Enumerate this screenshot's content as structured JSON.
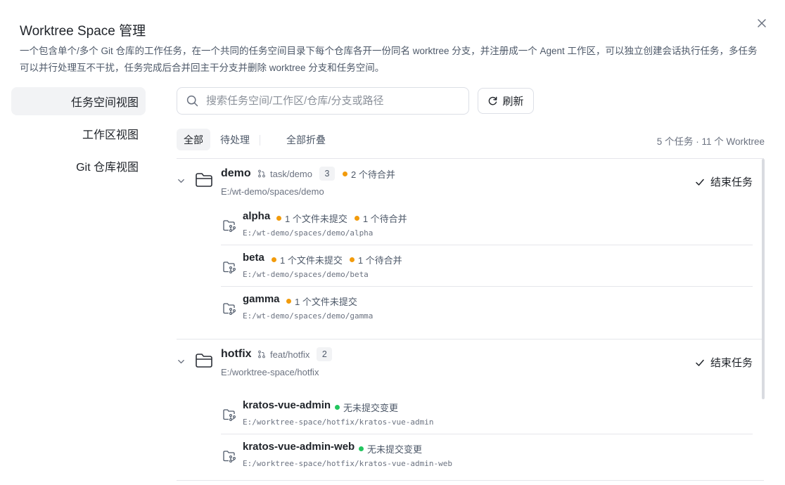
{
  "dialog": {
    "title": "Worktree Space 管理",
    "description": "一个包含单个/多个 Git 仓库的工作任务，在一个共同的任务空间目录下每个仓库各开一份同名 worktree 分支，并注册成一个 Agent 工作区，可以独立创建会话执行任务，多任务可以并行处理互不干扰，任务完成后合并回主干分支并删除 worktree 分支和任务空间。"
  },
  "sidebar": {
    "items": [
      {
        "label": "任务空间视图",
        "active": true
      },
      {
        "label": "工作区视图",
        "active": false
      },
      {
        "label": "Git 仓库视图",
        "active": false
      }
    ]
  },
  "search": {
    "placeholder": "搜索任务空间/工作区/仓库/分支或路径",
    "value": ""
  },
  "refresh_label": "刷新",
  "filters": {
    "all": "全部",
    "pending": "待处理",
    "collapse_all": "全部折叠",
    "summary": "5 个任务 · 11 个 Worktree"
  },
  "finish_label": "结束任务",
  "spaces": [
    {
      "name": "demo",
      "branch": "task/demo",
      "count": "3",
      "pending": "2 个待合并",
      "path": "E:/wt-demo/spaces/demo",
      "worktrees": [
        {
          "name": "alpha",
          "uncommitted": "1 个文件未提交",
          "merge": "1 个待合并",
          "path": "E:/wt-demo/spaces/demo/alpha"
        },
        {
          "name": "beta",
          "uncommitted": "1 个文件未提交",
          "merge": "1 个待合并",
          "path": "E:/wt-demo/spaces/demo/beta"
        },
        {
          "name": "gamma",
          "uncommitted": "1 个文件未提交",
          "path": "E:/wt-demo/spaces/demo/gamma"
        }
      ]
    },
    {
      "name": "hotfix",
      "branch": "feat/hotfix",
      "count": "2",
      "path": "E:/worktree-space/hotfix",
      "worktrees": [
        {
          "name": "kratos-vue-admin",
          "clean": "无未提交变更",
          "path": "E:/worktree-space/hotfix/kratos-vue-admin"
        },
        {
          "name": "kratos-vue-admin-web",
          "clean": "无未提交变更",
          "path": "E:/worktree-space/hotfix/kratos-vue-admin-web"
        }
      ]
    }
  ],
  "colors": {
    "pending": "#f29b0c",
    "clean": "#22c55e",
    "border": "#e5e6eb",
    "active_bg": "#f2f3f5"
  },
  "icons": [
    "close-icon",
    "search-icon",
    "refresh-icon",
    "chevron-down-icon",
    "folder-icon",
    "branch-icon",
    "check-icon",
    "worktree-icon"
  ]
}
